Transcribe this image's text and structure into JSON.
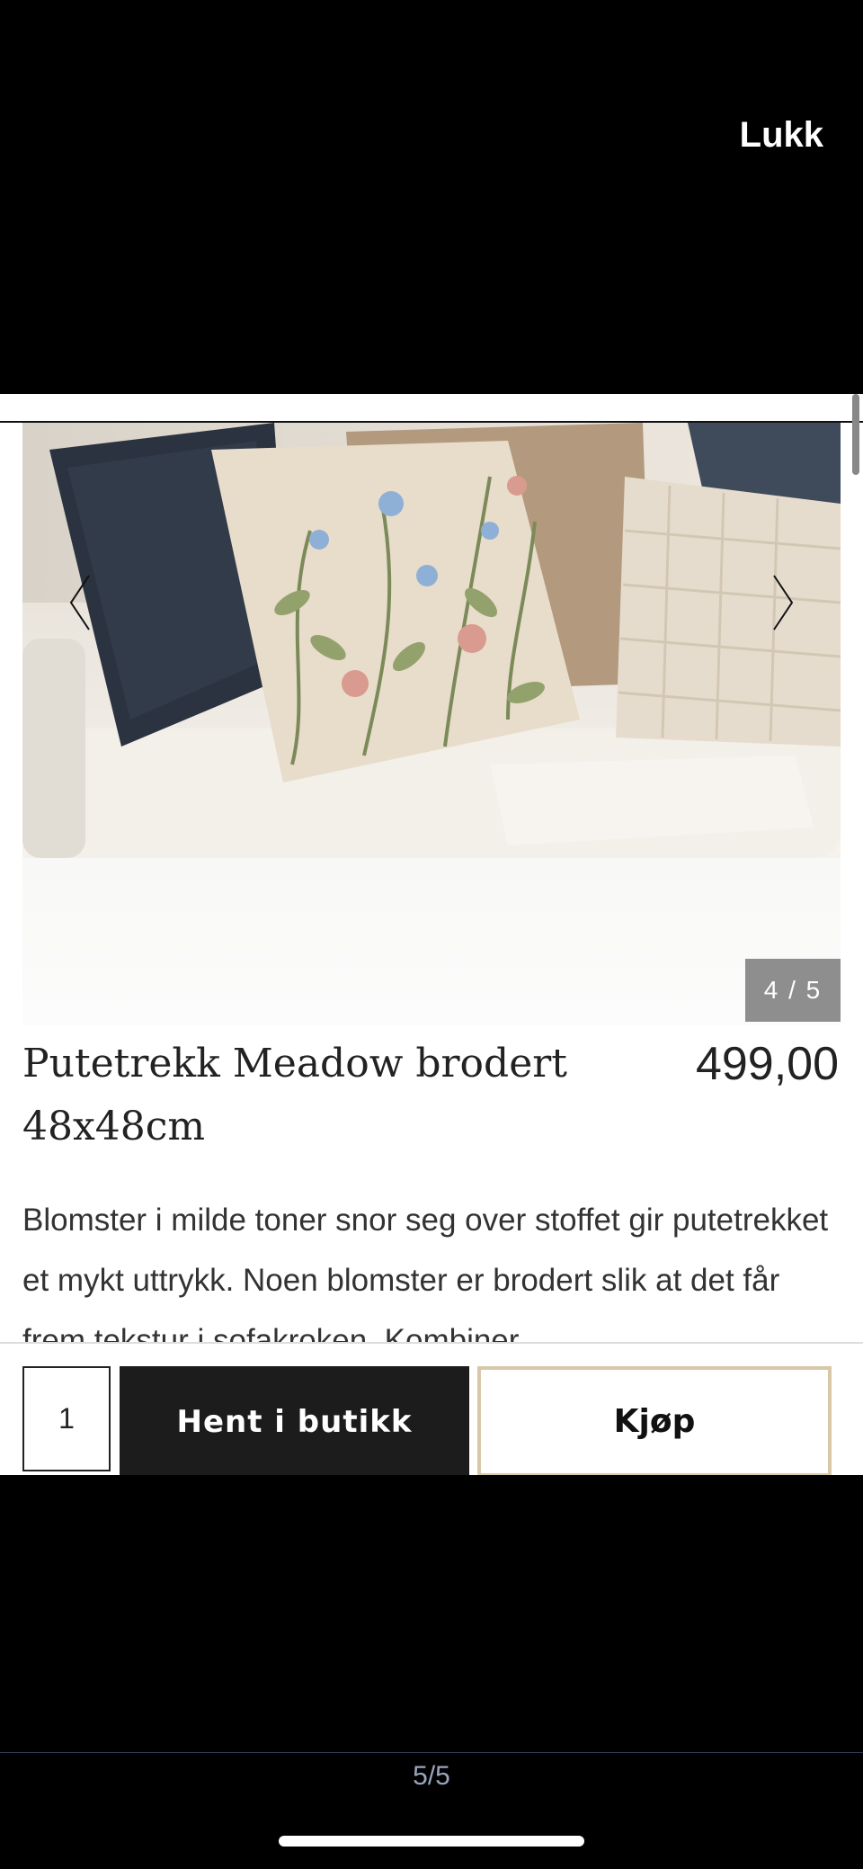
{
  "overlay": {
    "close_label": "Lukk",
    "page_indicator": "5/5"
  },
  "gallery": {
    "counter": "4 / 5",
    "prev_icon": "chevron-left-icon",
    "next_icon": "chevron-right-icon"
  },
  "product": {
    "title": "Putetrekk Meadow brodert 48x48cm",
    "price": "499,00",
    "description": "Blomster i milde toner snor seg over stoffet gir putetrekket et mykt uttrykk. Noen blomster er brodert slik at det får frem tekstur i sofakroken. Kombiner"
  },
  "actions": {
    "quantity": "1",
    "pickup_label": "Hent i butikk",
    "buy_label": "Kjøp"
  },
  "colors": {
    "dark_button": "#1c1c1c",
    "buy_border": "#d9c8a8",
    "counter_bg": "#8e8e8e"
  }
}
